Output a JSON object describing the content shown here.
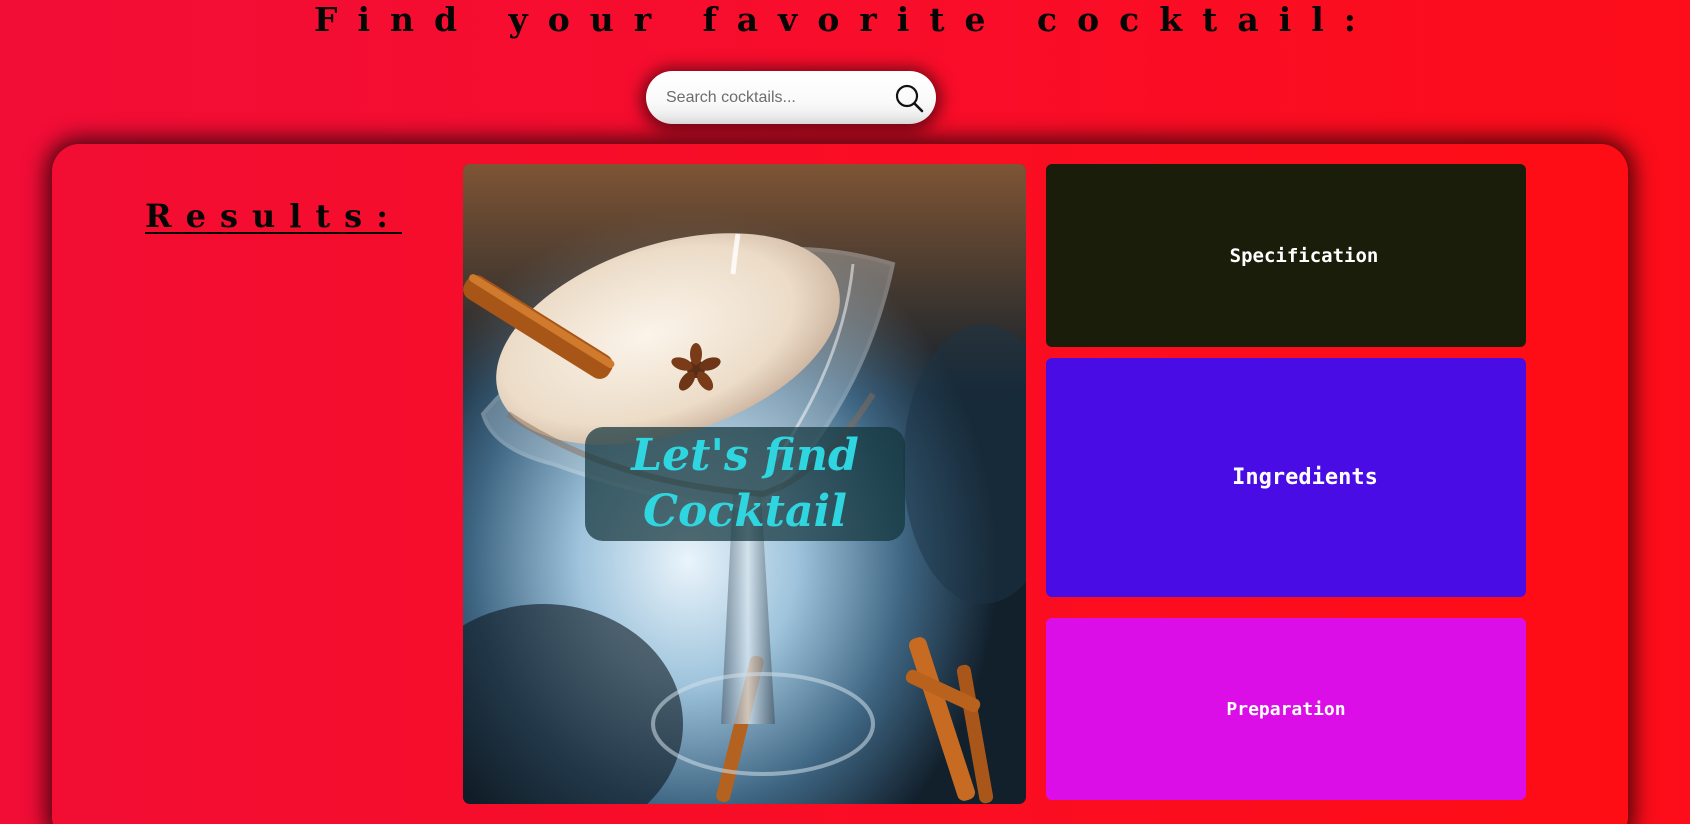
{
  "header": {
    "title": "Find your favorite cocktail:"
  },
  "search": {
    "placeholder": "Search cocktails...",
    "value": "",
    "icon": "search-icon"
  },
  "results": {
    "heading": "Results:"
  },
  "featured": {
    "overlay_text": "Let's find Cocktail",
    "image": "cocktail-photo"
  },
  "cards": {
    "specification": "Specification",
    "ingredients": "Ingredients",
    "preparation": "Preparation"
  },
  "colors": {
    "background": "#f80d2b",
    "specification_card": "#1b1d0b",
    "ingredients_card": "#4a0ce4",
    "preparation_card": "#dc0ee8",
    "overlay_text": "#2fd5df"
  }
}
